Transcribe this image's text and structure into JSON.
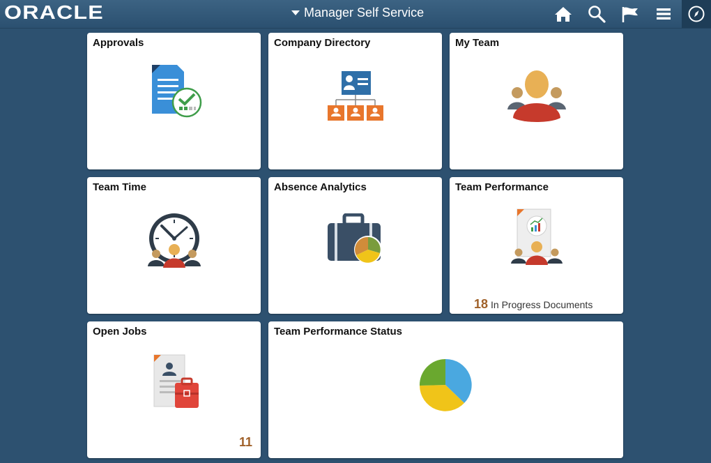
{
  "header": {
    "logo": "ORACLE",
    "page_title": "Manager Self Service",
    "icons": [
      "home-icon",
      "search-icon",
      "flag-icon",
      "menu-icon",
      "navbar-compass-icon"
    ]
  },
  "colors": {
    "background": "#2d5170",
    "header": "#3c6383",
    "count": "#a0612a"
  },
  "tiles": [
    {
      "title": "Approvals",
      "icon": "approvals-document-check-icon"
    },
    {
      "title": "Company Directory",
      "icon": "org-chart-icon"
    },
    {
      "title": "My Team",
      "icon": "team-people-icon"
    },
    {
      "title": "Team Time",
      "icon": "clock-people-icon"
    },
    {
      "title": "Absence Analytics",
      "icon": "briefcase-pie-icon"
    },
    {
      "title": "Team Performance",
      "icon": "performance-document-people-icon",
      "count": "18",
      "count_label": "In Progress Documents"
    },
    {
      "title": "Open Jobs",
      "icon": "job-resume-briefcase-icon",
      "count": "11"
    },
    {
      "title": "Team Performance Status",
      "icon": "pie-chart-icon"
    }
  ]
}
